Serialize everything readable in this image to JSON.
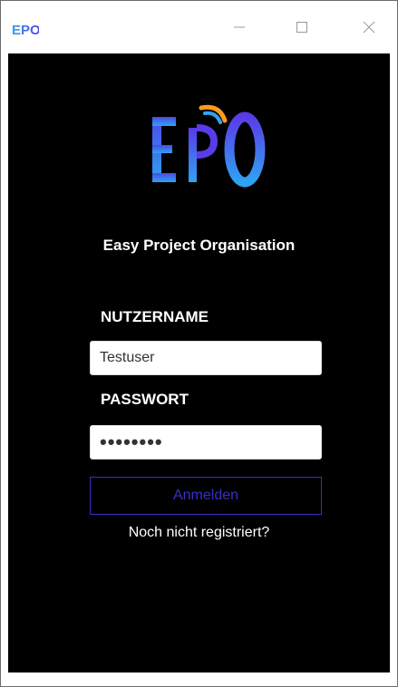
{
  "window": {
    "title_icon_text": "EPO",
    "minimize_icon": "minimize-icon",
    "maximize_icon": "maximize-icon",
    "close_icon": "close-icon"
  },
  "logo": {
    "text": "EPO",
    "colors": [
      "#2fa3f2",
      "#5a3be8",
      "#ff9a1f"
    ]
  },
  "app": {
    "title": "Easy Project Organisation"
  },
  "login": {
    "username_label": "NUTZERNAME",
    "username_value": "Testuser",
    "password_label": "PASSWORT",
    "password_value": "••••••••",
    "submit_label": "Anmelden",
    "register_link": "Noch nicht registriert?"
  },
  "colors": {
    "background": "#000000",
    "accent": "#3b2fc6",
    "text": "#ffffff"
  }
}
